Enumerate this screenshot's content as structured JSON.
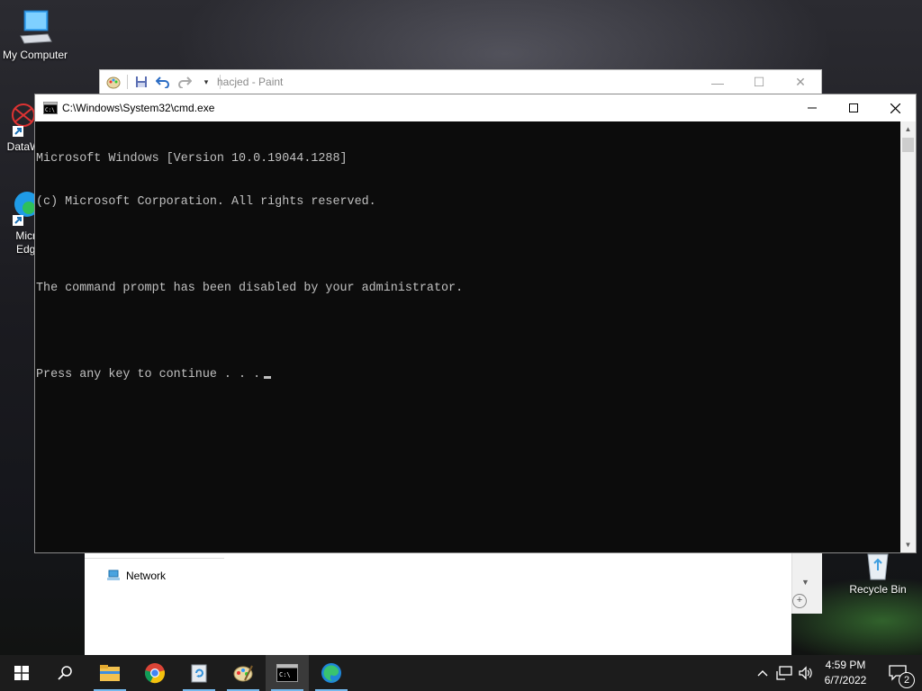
{
  "desktop": {
    "icons": [
      {
        "label": "My Computer"
      },
      {
        "label": "DataW"
      },
      {
        "label": "Micro"
      },
      {
        "label": "Edge"
      },
      {
        "label": "Recycle Bin"
      }
    ]
  },
  "paint": {
    "title": "hacjed - Paint",
    "controls": {
      "minimize": "—",
      "maximize": "☐",
      "close": "✕"
    }
  },
  "explorer": {
    "network_label": "Network"
  },
  "cmd": {
    "title": "C:\\Windows\\System32\\cmd.exe",
    "lines": [
      "Microsoft Windows [Version 10.0.19044.1288]",
      "(c) Microsoft Corporation. All rights reserved.",
      "",
      "The command prompt has been disabled by your administrator.",
      "",
      "Press any key to continue . . ."
    ],
    "controls": {
      "minimize": "—",
      "maximize": "☐",
      "close": "✕"
    }
  },
  "taskbar": {
    "start_icon": "windows-logo-icon",
    "apps": [
      "search-icon",
      "file-explorer-icon",
      "chrome-icon",
      "recycle-tool-icon",
      "paint-icon",
      "cmd-icon",
      "edge-icon"
    ],
    "clock": {
      "time": "4:59 PM",
      "date": "6/7/2022"
    },
    "notification_count": "2"
  }
}
